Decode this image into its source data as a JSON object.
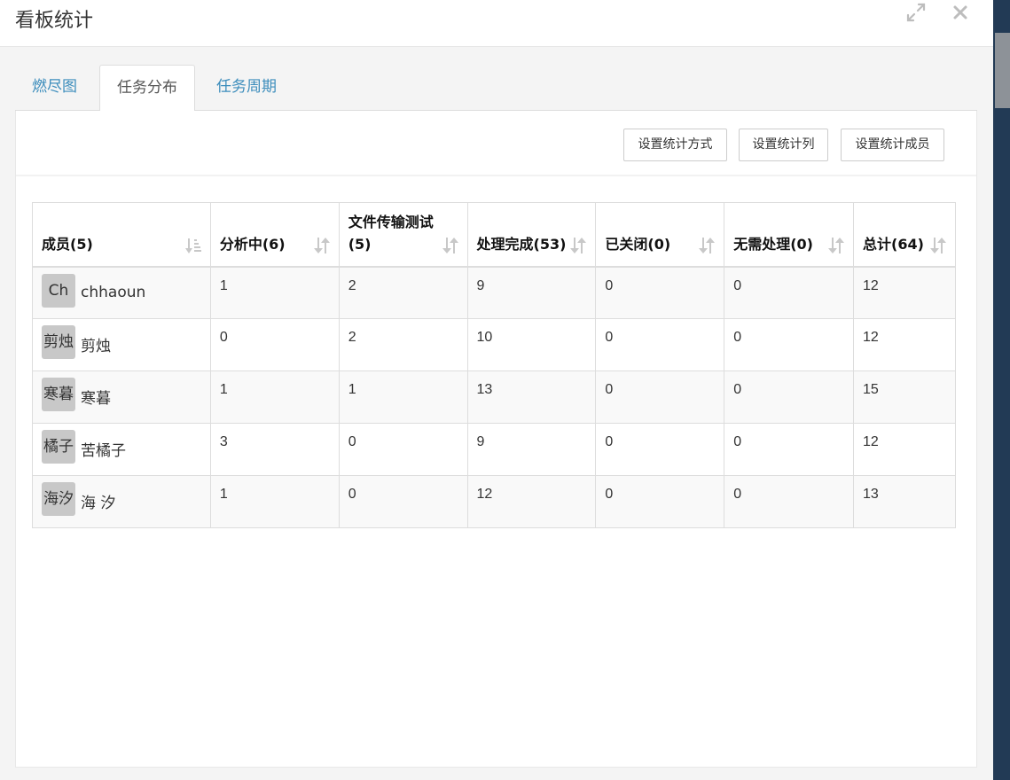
{
  "modal": {
    "title": "看板统计"
  },
  "tabs": [
    {
      "label": "燃尽图",
      "active": false
    },
    {
      "label": "任务分布",
      "active": true
    },
    {
      "label": "任务周期",
      "active": false
    }
  ],
  "toolbar": {
    "set_method": "设置统计方式",
    "set_columns": "设置统计列",
    "set_members": "设置统计成员"
  },
  "table": {
    "headers": [
      "成员(5)",
      "分析中(6)",
      "文件传输测试(5)",
      "处理完成(53)",
      "已关闭(0)",
      "无需处理(0)",
      "总计(64)"
    ],
    "rows": [
      {
        "avatar": "Ch",
        "name": "chhaoun",
        "cells": [
          "1",
          "2",
          "9",
          "0",
          "0",
          "12"
        ]
      },
      {
        "avatar": "剪烛",
        "name": "剪烛",
        "cells": [
          "0",
          "2",
          "10",
          "0",
          "0",
          "12"
        ]
      },
      {
        "avatar": "寒暮",
        "name": "寒暮",
        "cells": [
          "1",
          "1",
          "13",
          "0",
          "0",
          "15"
        ]
      },
      {
        "avatar": "橘子",
        "name": "苦橘子",
        "cells": [
          "3",
          "0",
          "9",
          "0",
          "0",
          "12"
        ]
      },
      {
        "avatar": "海汐",
        "name": "海 汐",
        "cells": [
          "1",
          "0",
          "12",
          "0",
          "0",
          "13"
        ]
      }
    ]
  },
  "icons": {
    "expand": "expand-icon",
    "close": "close-icon",
    "sort": "sort-icon"
  },
  "colors": {
    "link": "#3c8dbc",
    "avatar_bg": "#c8c8c8",
    "app_bg": "#223a55"
  }
}
